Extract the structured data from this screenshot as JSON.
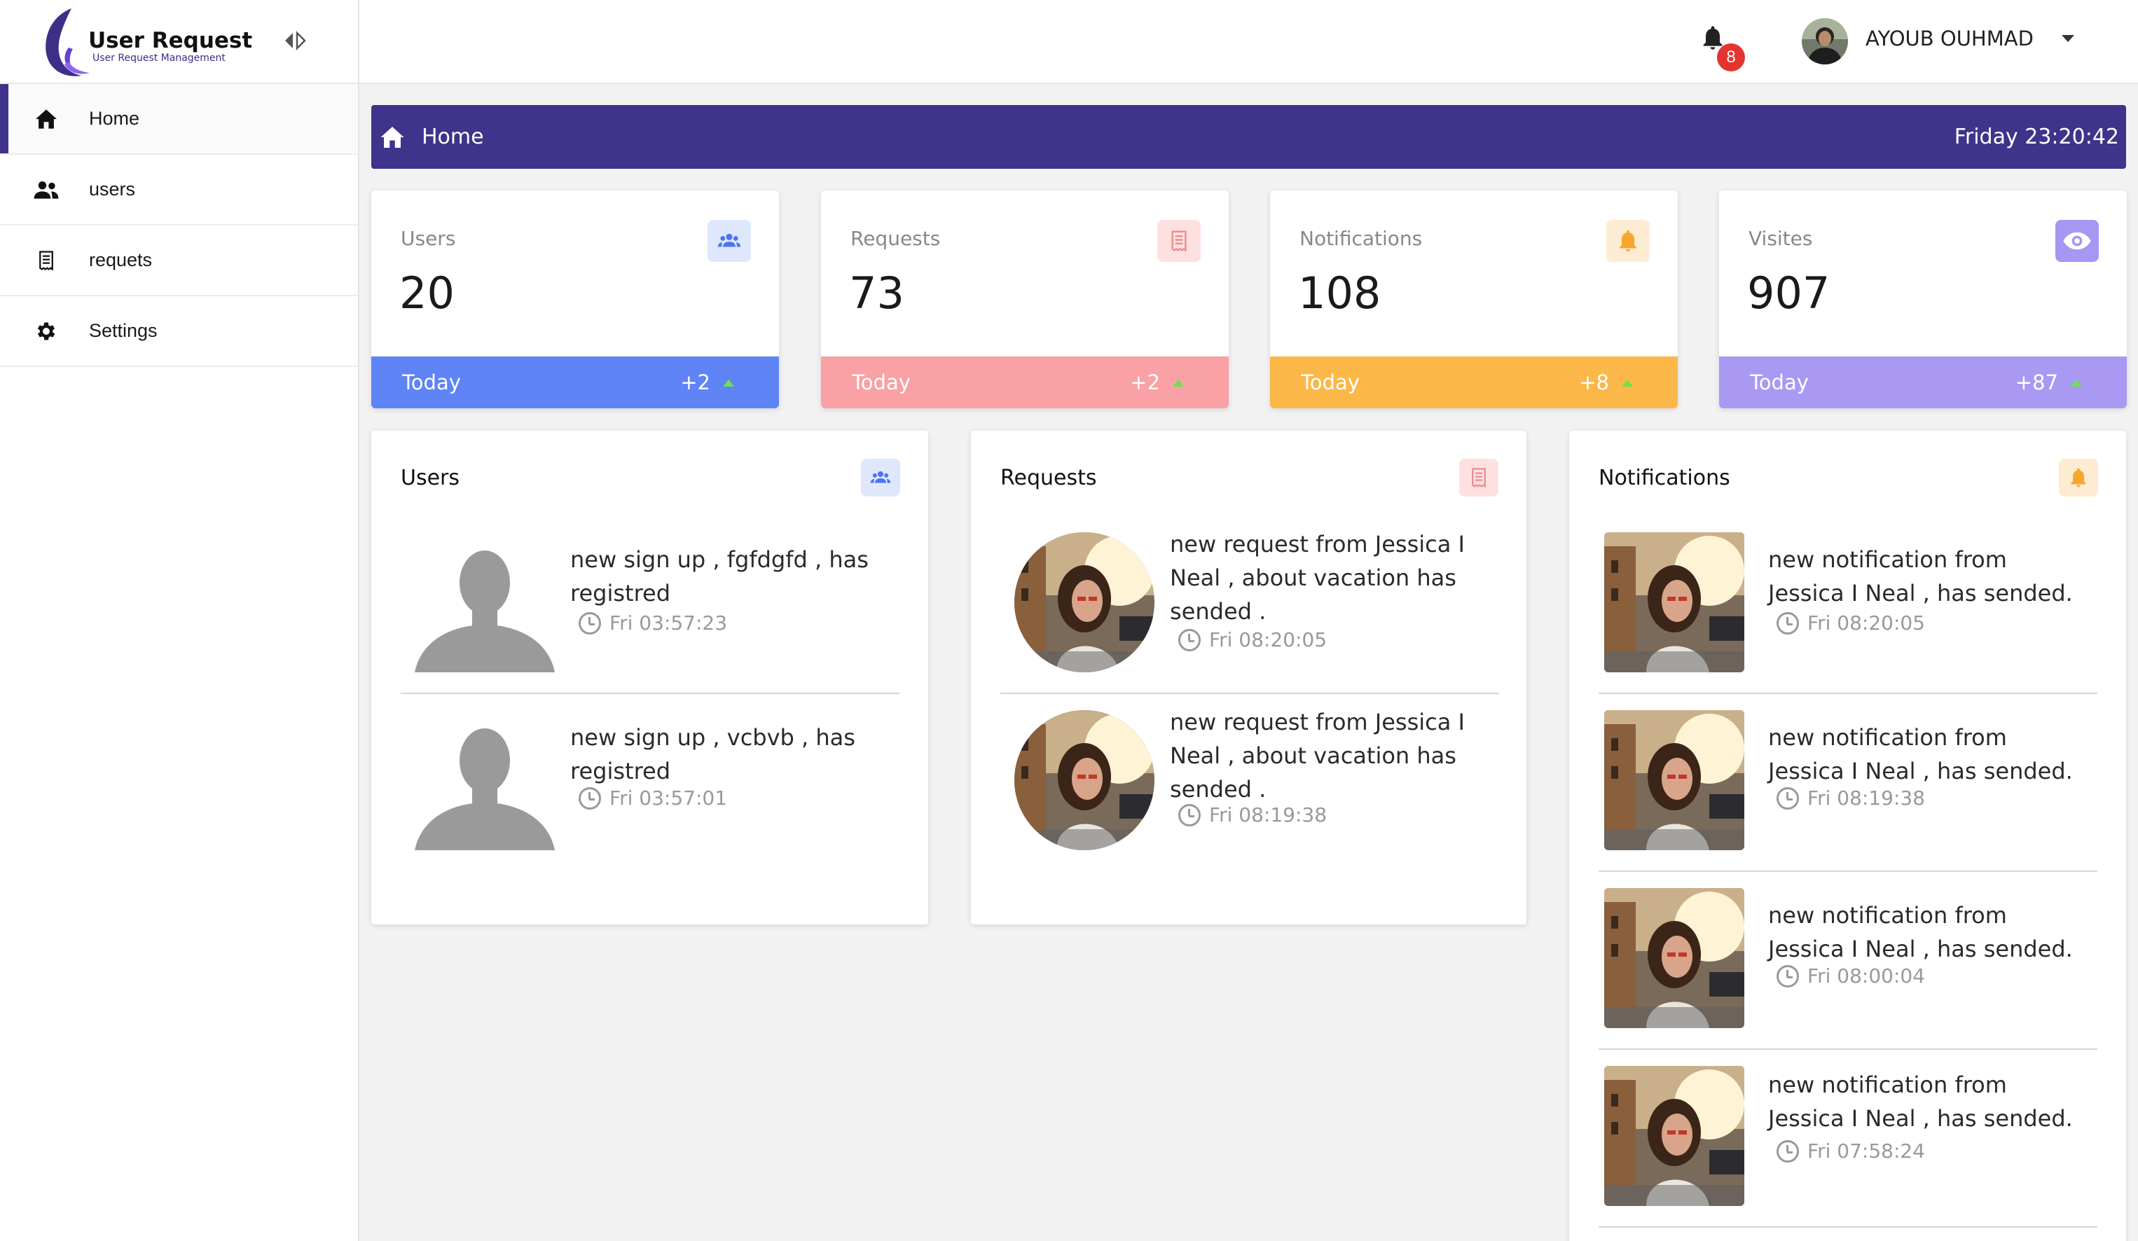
{
  "brand": {
    "title": "User Request",
    "subtitle": "User Request Management"
  },
  "sidebar": {
    "items": [
      {
        "label": "Home",
        "icon": "home-icon",
        "active": true
      },
      {
        "label": "users",
        "icon": "users-icon",
        "active": false
      },
      {
        "label": "requets",
        "icon": "receipt-icon",
        "active": false
      },
      {
        "label": "Settings",
        "icon": "gear-icon",
        "active": false
      }
    ]
  },
  "topbar": {
    "notification_count": "8",
    "user_name": "AYOUB OUHMAD"
  },
  "banner": {
    "title": "Home",
    "datetime": "Friday 23:20:42"
  },
  "stats": [
    {
      "label": "Users",
      "value": "20",
      "footer": "Today",
      "delta": "+2",
      "icon": "users-icon",
      "color": "#5e84f6",
      "icon_bg": "#dfe7fd",
      "icon_color": "#4c74f2"
    },
    {
      "label": "Requests",
      "value": "73",
      "footer": "Today",
      "delta": "+2",
      "icon": "receipt-icon",
      "color": "#f9a1a4",
      "icon_bg": "#fde1e1",
      "icon_color": "#ef8a8d"
    },
    {
      "label": "Notifications",
      "value": "108",
      "footer": "Today",
      "delta": "+8",
      "icon": "bell-icon",
      "color": "#fbb848",
      "icon_bg": "#fdecd2",
      "icon_color": "#f7a72c"
    },
    {
      "label": "Visites",
      "value": "907",
      "footer": "Today",
      "delta": "+87",
      "icon": "eye-icon",
      "color": "#a999f3",
      "icon_bg": "#a597f2",
      "icon_color": "#ffffff"
    }
  ],
  "users_panel": {
    "title": "Users",
    "items": [
      {
        "text_line1": "new sign up , fgfdgfd , has",
        "text_line2": "registred",
        "time": "Fri 03:57:23"
      },
      {
        "text_line1": "new sign up , vcbvb , has",
        "text_line2": "registred",
        "time": "Fri 03:57:01"
      }
    ]
  },
  "requests_panel": {
    "title": "Requests",
    "items": [
      {
        "text_line1": "new request from Jessica I",
        "text_line2": "Neal , about vacation has",
        "text_line3": "sended .",
        "time": "Fri 08:20:05"
      },
      {
        "text_line1": "new request from Jessica I",
        "text_line2": "Neal , about vacation has",
        "text_line3": "sended .",
        "time": "Fri 08:19:38"
      }
    ]
  },
  "notifications_panel": {
    "title": "Notifications",
    "items": [
      {
        "text_line1": "new notification from",
        "text_line2": "Jessica I Neal , has sended.",
        "time": "Fri 08:20:05"
      },
      {
        "text_line1": "new notification from",
        "text_line2": "Jessica I Neal , has sended.",
        "time": "Fri 08:19:38"
      },
      {
        "text_line1": "new notification from",
        "text_line2": "Jessica I Neal , has sended.",
        "time": "Fri 08:00:04"
      },
      {
        "text_line1": "new notification from",
        "text_line2": "Jessica I Neal , has sended.",
        "time": "Fri 07:58:24"
      }
    ]
  }
}
